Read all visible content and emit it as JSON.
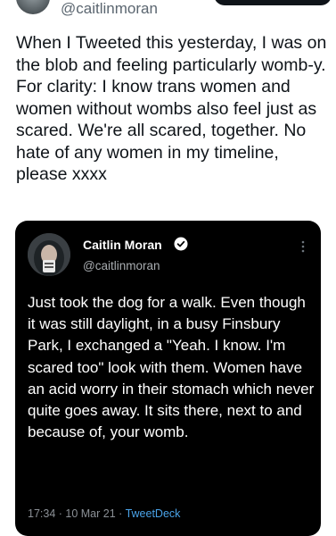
{
  "header": {
    "handle": "@caitlinmoran"
  },
  "tweet": {
    "text": "When I Tweeted this yesterday, I was on the blob and feeling particularly womb-y. For clarity: I know trans women and women without wombs also feel just as scared. We're all scared, together. No hate of any women in my timeline, please xxxx"
  },
  "quoted": {
    "name": "Caitlin Moran",
    "handle": "@caitlinmoran",
    "text": "Just took the dog for a walk. Even though it was still daylight, in a busy Finsbury Park, I exchanged a \"Yeah. I know. I'm scared too\" look with them. Women have an acid worry in their stomach which never quite goes away. It sits there, next to and because of, your womb.",
    "time": "17:34",
    "date": "10 Mar 21",
    "source": "TweetDeck",
    "separator": " · "
  },
  "icons": {
    "verified": "verified-badge-icon",
    "more": "more-options-icon"
  },
  "colors": {
    "card_bg": "#000000",
    "link_blue": "#4aa3e8",
    "muted": "#5b6670"
  }
}
